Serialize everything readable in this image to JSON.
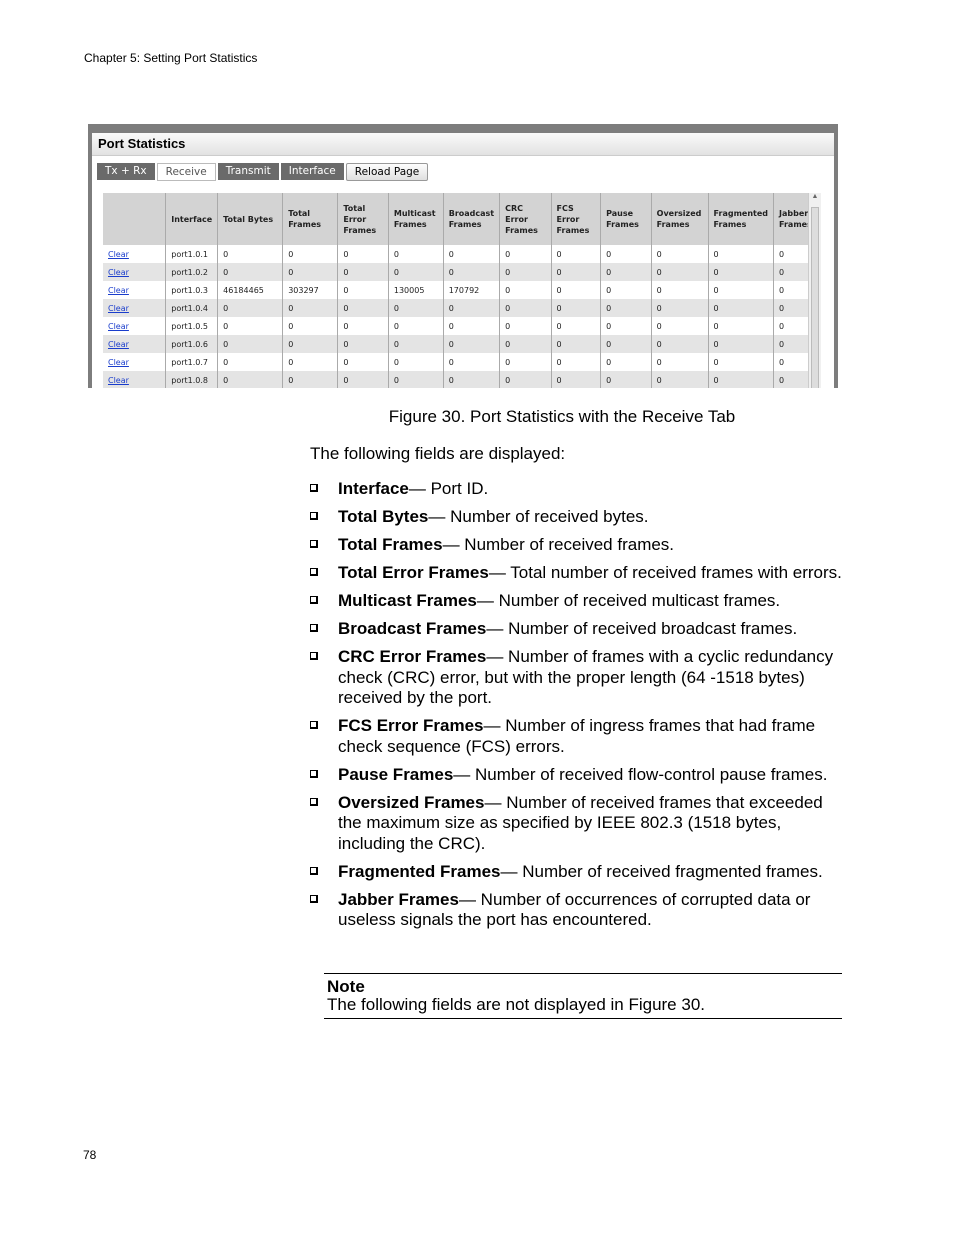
{
  "running_head": "Chapter 5: Setting Port Statistics",
  "page_number": "78",
  "screenshot": {
    "title": "Port Statistics",
    "tabs": [
      {
        "label": "Tx + Rx",
        "active": false
      },
      {
        "label": "Receive",
        "active": true
      },
      {
        "label": "Transmit",
        "active": false
      },
      {
        "label": "Interface",
        "active": false
      }
    ],
    "reload_label": "Reload Page",
    "columns": [
      "",
      "Interface",
      "Total Bytes",
      "Total Frames",
      "Total Error Frames",
      "Multicast Frames",
      "Broadcast Frames",
      "CRC Error Frames",
      "FCS Error Frames",
      "Pause Frames",
      "Oversized Frames",
      "Fragmented Frames",
      "Jabber Frames"
    ],
    "clear_label": "Clear",
    "rows": [
      [
        "port1.0.1",
        "0",
        "0",
        "0",
        "0",
        "0",
        "0",
        "0",
        "0",
        "0",
        "0",
        "0"
      ],
      [
        "port1.0.2",
        "0",
        "0",
        "0",
        "0",
        "0",
        "0",
        "0",
        "0",
        "0",
        "0",
        "0"
      ],
      [
        "port1.0.3",
        "46184465",
        "303297",
        "0",
        "130005",
        "170792",
        "0",
        "0",
        "0",
        "0",
        "0",
        "0"
      ],
      [
        "port1.0.4",
        "0",
        "0",
        "0",
        "0",
        "0",
        "0",
        "0",
        "0",
        "0",
        "0",
        "0"
      ],
      [
        "port1.0.5",
        "0",
        "0",
        "0",
        "0",
        "0",
        "0",
        "0",
        "0",
        "0",
        "0",
        "0"
      ],
      [
        "port1.0.6",
        "0",
        "0",
        "0",
        "0",
        "0",
        "0",
        "0",
        "0",
        "0",
        "0",
        "0"
      ],
      [
        "port1.0.7",
        "0",
        "0",
        "0",
        "0",
        "0",
        "0",
        "0",
        "0",
        "0",
        "0",
        "0"
      ],
      [
        "port1.0.8",
        "0",
        "0",
        "0",
        "0",
        "0",
        "0",
        "0",
        "0",
        "0",
        "0",
        "0"
      ]
    ]
  },
  "caption": "Figure 30. Port Statistics with the Receive Tab",
  "intro": "The following fields are displayed:",
  "fields": [
    {
      "term": "Interface",
      "desc": "— Port ID."
    },
    {
      "term": "Total Bytes",
      "desc": "— Number of received bytes."
    },
    {
      "term": "Total Frames",
      "desc": "— Number of received frames."
    },
    {
      "term": "Total Error Frames",
      "desc": "— Total number of received frames with errors."
    },
    {
      "term": "Multicast Frames",
      "desc": "— Number of received multicast frames."
    },
    {
      "term": "Broadcast Frames",
      "desc": "— Number of received broadcast frames."
    },
    {
      "term": "CRC Error Frames",
      "desc": "— Number of frames with a cyclic redundancy check (CRC) error, but with the proper length (64 -1518 bytes) received by the port."
    },
    {
      "term": "FCS Error Frames",
      "desc": "— Number of ingress frames that had frame check sequence (FCS) errors."
    },
    {
      "term": "Pause Frames",
      "desc": "— Number of received flow-control pause frames."
    },
    {
      "term": "Oversized Frames",
      "desc": "— Number of received frames that exceeded the maximum size as specified by IEEE 802.3 (1518 bytes, including the CRC)."
    },
    {
      "term": "Fragmented Frames",
      "desc": "— Number of received fragmented frames."
    },
    {
      "term": "Jabber Frames",
      "desc": "— Number of occurrences of corrupted data or useless signals the port has encountered."
    }
  ],
  "note": {
    "title": "Note",
    "text": "The following fields are not displayed in Figure 30."
  }
}
